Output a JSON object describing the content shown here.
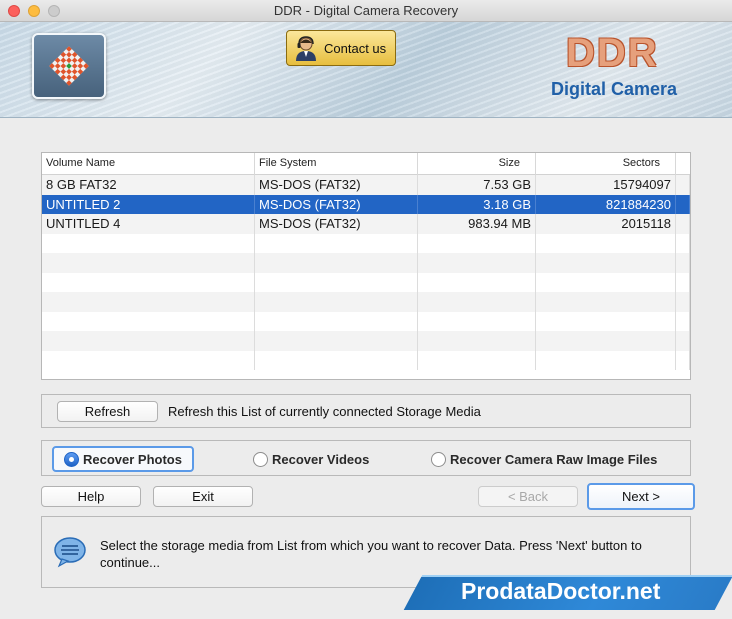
{
  "window": {
    "title": "DDR - Digital Camera Recovery"
  },
  "header": {
    "contact_label": "Contact us",
    "brand_title": "DDR",
    "brand_subtitle": "Digital Camera"
  },
  "table": {
    "columns": [
      "Volume Name",
      "File System",
      "Size",
      "Sectors"
    ],
    "rows": [
      {
        "volume": "8 GB FAT32",
        "fs": "MS-DOS (FAT32)",
        "size": "7.53  GB",
        "sectors": "15794097",
        "selected": false
      },
      {
        "volume": "UNTITLED 2",
        "fs": "MS-DOS (FAT32)",
        "size": "3.18  GB",
        "sectors": "821884230",
        "selected": true
      },
      {
        "volume": "UNTITLED 4",
        "fs": "MS-DOS (FAT32)",
        "size": "983.94  MB",
        "sectors": "2015118",
        "selected": false
      }
    ]
  },
  "refresh": {
    "button_label": "Refresh",
    "description": "Refresh this List of currently connected Storage Media"
  },
  "options": {
    "photos": "Recover Photos",
    "videos": "Recover Videos",
    "raw": "Recover Camera Raw Image Files",
    "selected": "photos"
  },
  "buttons": {
    "help": "Help",
    "exit": "Exit",
    "back": "< Back",
    "next": "Next >"
  },
  "info": {
    "message": "Select the storage media from List from which you want to recover Data. Press 'Next' button to continue..."
  },
  "promo": {
    "text": "ProdataDoctor.net"
  },
  "colors": {
    "selection": "#2265c5",
    "brand_orange": "#e6a07c",
    "brand_blue": "#2060a8",
    "focus_ring": "#5b9ae8"
  }
}
